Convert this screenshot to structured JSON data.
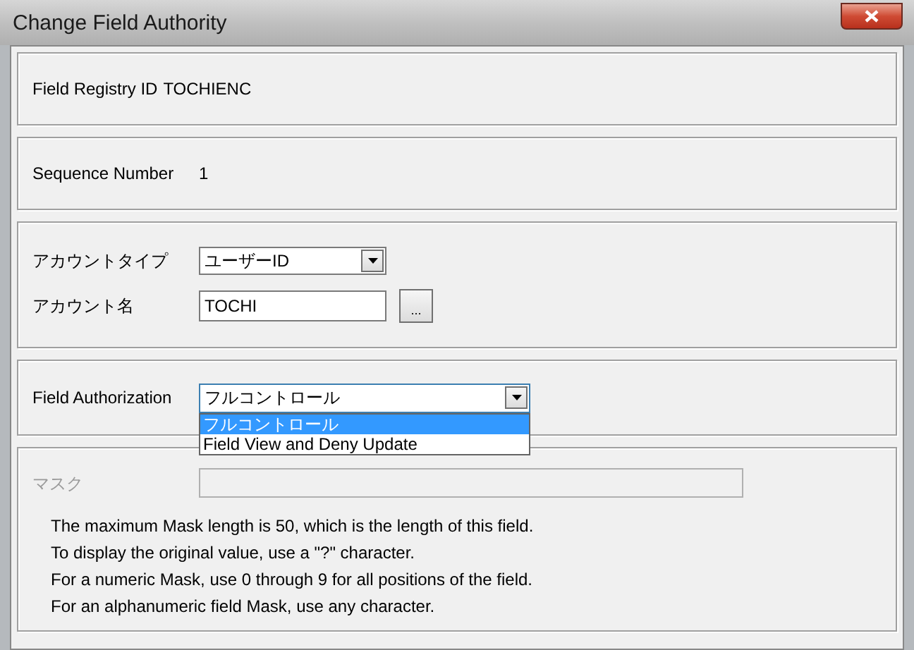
{
  "window": {
    "title": "Change Field Authority"
  },
  "field_registry": {
    "label": "Field Registry ID",
    "value": "TOCHIENC"
  },
  "sequence": {
    "label": "Sequence Number",
    "value": "1"
  },
  "account_type": {
    "label": "アカウントタイプ",
    "value": "ユーザーID"
  },
  "account_name": {
    "label": "アカウント名",
    "value": "TOCHI",
    "browse_button": "..."
  },
  "field_authorization": {
    "label": "Field Authorization",
    "value": "フルコントロール",
    "expanded": true,
    "options": [
      {
        "label": "フルコントロール",
        "selected": true
      },
      {
        "label": "Field View and Deny Update",
        "selected": false
      }
    ]
  },
  "mask": {
    "label": "マスク",
    "disabled": true
  },
  "help_lines": [
    "The maximum Mask length is 50, which is the length of this field.",
    "To display the original value, use a \"?\" character.",
    "For a numeric Mask, use 0 through 9 for all positions of the field.",
    "For an alphanumeric field Mask, use any character."
  ]
}
